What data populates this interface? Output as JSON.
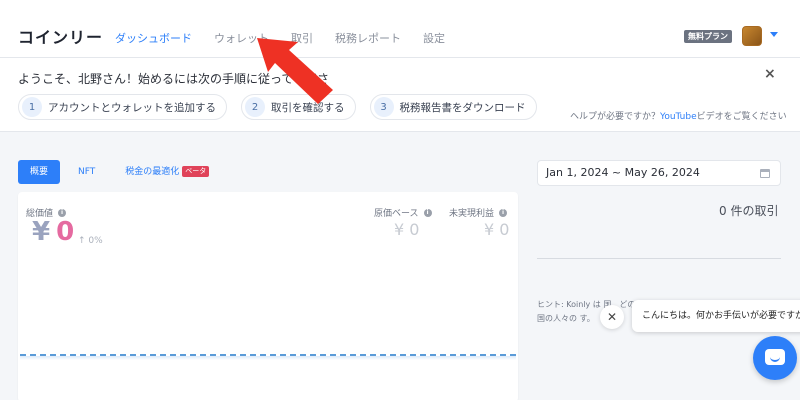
{
  "header": {
    "brand": "コインリー",
    "nav": [
      "ダッシュボード",
      "ウォレット",
      "取引",
      "税務レポート",
      "設定"
    ],
    "plan_badge": "無料プラン"
  },
  "banner": {
    "welcome": "ようこそ、北野さん！始めるには次の手順に従ってくださ",
    "close": "×",
    "steps": [
      {
        "num": "1",
        "label": "アカウントとウォレットを追加する"
      },
      {
        "num": "2",
        "label": "取引を確認する"
      },
      {
        "num": "3",
        "label": "税務報告書をダウンロード"
      }
    ],
    "help_prefix": "ヘルプが必要ですか？",
    "help_link": "YouTube",
    "help_suffix": "ビデオをご覧ください"
  },
  "tabs": {
    "overview": "概要",
    "nft": "NFT",
    "tax_opt": "税金の最適化",
    "beta": "ベータ"
  },
  "portfolio": {
    "total_label": "総価値",
    "currency": "¥",
    "total_value": "0",
    "change": "0%",
    "cost_label": "原価ベース",
    "cost_value": "¥ 0",
    "unrealized_label": "未実現利益",
    "unrealized_value": "¥ 0"
  },
  "sidebar": {
    "date_range": "Jan 1, 2024 ~ May 26, 2024",
    "tx_count": "0 件の取引",
    "hint": "ヒント: Koinly は 国、どの国の人々の す。"
  },
  "chat": {
    "close": "✕",
    "message": "こんにちは。何かお手伝いが必要ですか?"
  },
  "colors": {
    "accent": "#2d7ff9",
    "arrow": "#ee3124",
    "beta": "#e0435a"
  }
}
